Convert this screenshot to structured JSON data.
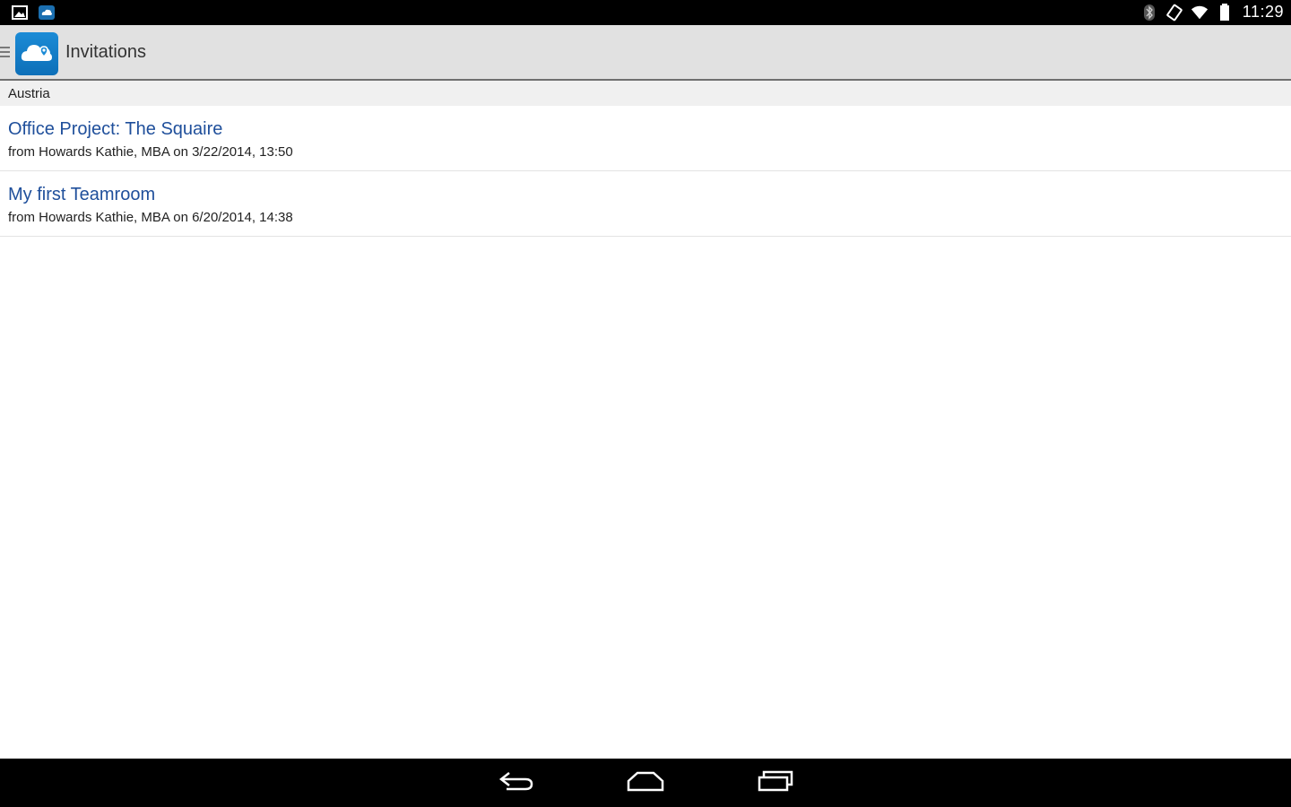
{
  "status_bar": {
    "time": "11:29",
    "left_icons": [
      "gallery-icon",
      "app-notification-icon"
    ],
    "right_icons": [
      "bluetooth-icon",
      "rotation-lock-icon",
      "wifi-icon",
      "battery-icon"
    ]
  },
  "action_bar": {
    "title": "Invitations",
    "app_icon": "cloud-location-icon",
    "menu_icon": "menu-icon"
  },
  "section": {
    "header": "Austria"
  },
  "invitations": [
    {
      "title": "Office Project: The Squaire",
      "subtitle": "from Howards Kathie, MBA on 3/22/2014, 13:50"
    },
    {
      "title": "My first Teamroom",
      "subtitle": "from Howards Kathie, MBA on 6/20/2014, 14:38"
    }
  ],
  "nav_bar": {
    "buttons": [
      "back-icon",
      "home-icon",
      "recent-apps-icon"
    ]
  },
  "colors": {
    "accent": "#1f4f9b",
    "action_bar_bg": "#e1e1e1",
    "app_icon_bg": "#1b8bd6"
  }
}
